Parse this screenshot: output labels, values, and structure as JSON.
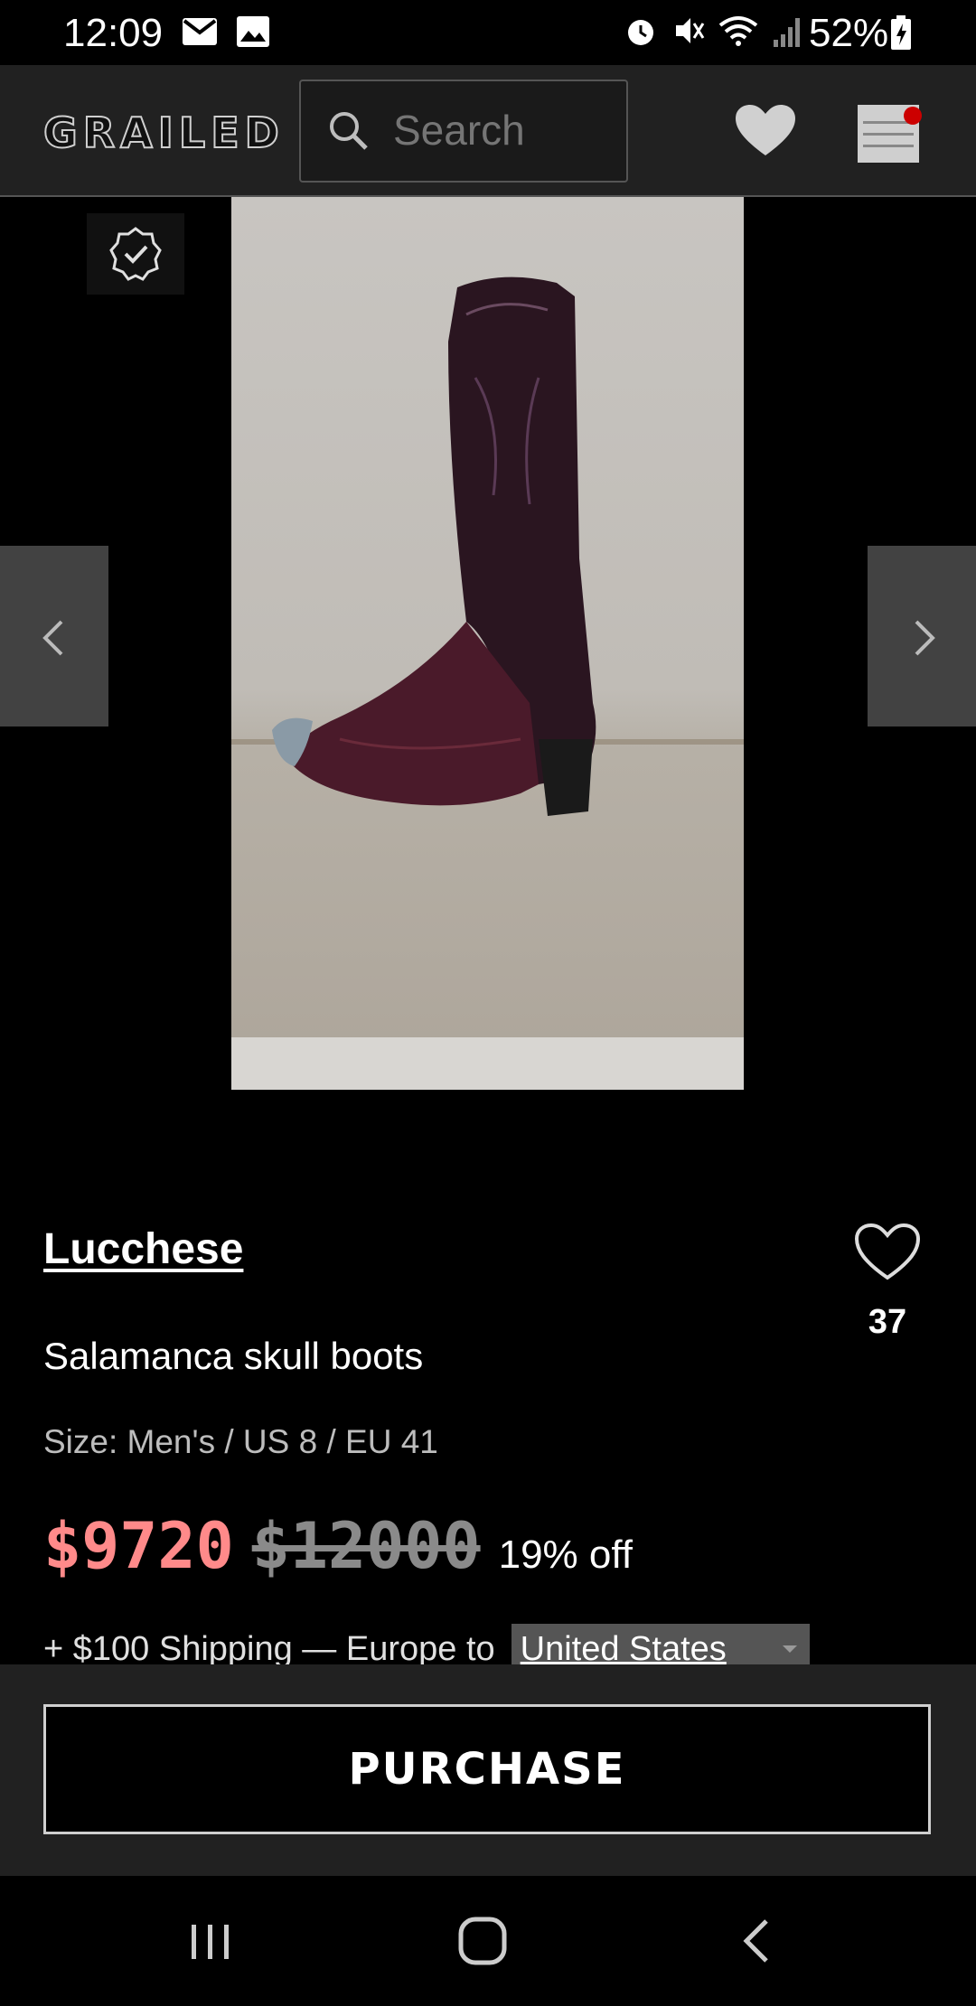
{
  "status_bar": {
    "time": "12:09",
    "battery": "52%"
  },
  "header": {
    "logo": "GRAILED",
    "search_placeholder": "Search"
  },
  "product": {
    "brand": "Lucchese",
    "name": "Salamanca skull boots",
    "size": "Size: Men's / US 8 / EU 41",
    "like_count": "37",
    "price_current": "$9720",
    "price_original": "$12000",
    "discount": "19% off",
    "shipping_text": "+ $100 Shipping — Europe to",
    "ship_country": "United States"
  },
  "actions": {
    "purchase_label": "PURCHASE"
  },
  "icons": {
    "status": [
      "email-icon",
      "gallery-icon",
      "alarm-icon",
      "mute-icon",
      "wifi-icon",
      "signal-icon",
      "battery-icon"
    ],
    "header": [
      "search-icon",
      "heart-icon",
      "menu-icon"
    ],
    "nav": [
      "recents-icon",
      "home-icon",
      "back-icon"
    ]
  },
  "colors": {
    "price": "#ff8a8a",
    "notification_dot": "#cc0000",
    "header_bg": "#212121"
  }
}
